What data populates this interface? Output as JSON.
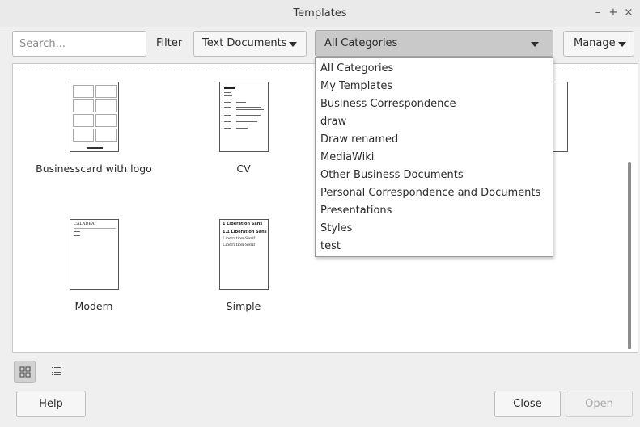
{
  "window": {
    "title": "Templates",
    "minimize": "–",
    "maximize": "+",
    "close": "×"
  },
  "toolbar": {
    "search_placeholder": "Search...",
    "filter_label": "Filter",
    "filter_value": "Text Documents",
    "category_value": "All Categories",
    "manage_label": "Manage"
  },
  "templates": [
    {
      "name": "Businesscard with logo"
    },
    {
      "name": "CV"
    },
    {
      "name": "ult"
    },
    {
      "name": "Modern"
    },
    {
      "name": "Simple"
    }
  ],
  "thumb_text": {
    "modern_head": "CALADEA",
    "simple_line1": "1   Liberation Sans",
    "simple_line2": "1.1  Liberation Sans",
    "simple_line3": "Liberation Serif",
    "simple_line4": "Liberation Serif"
  },
  "categories": [
    "All Categories",
    "My Templates",
    "Business Correspondence",
    "draw",
    "Draw renamed",
    "MediaWiki",
    "Other Business Documents",
    "Personal Correspondence and Documents",
    "Presentations",
    "Styles",
    "test"
  ],
  "footer": {
    "help_label": "Help",
    "close_label": "Close",
    "open_label": "Open"
  },
  "icons": {
    "thumbnail_view": "grid-view-icon",
    "list_view": "list-view-icon"
  }
}
